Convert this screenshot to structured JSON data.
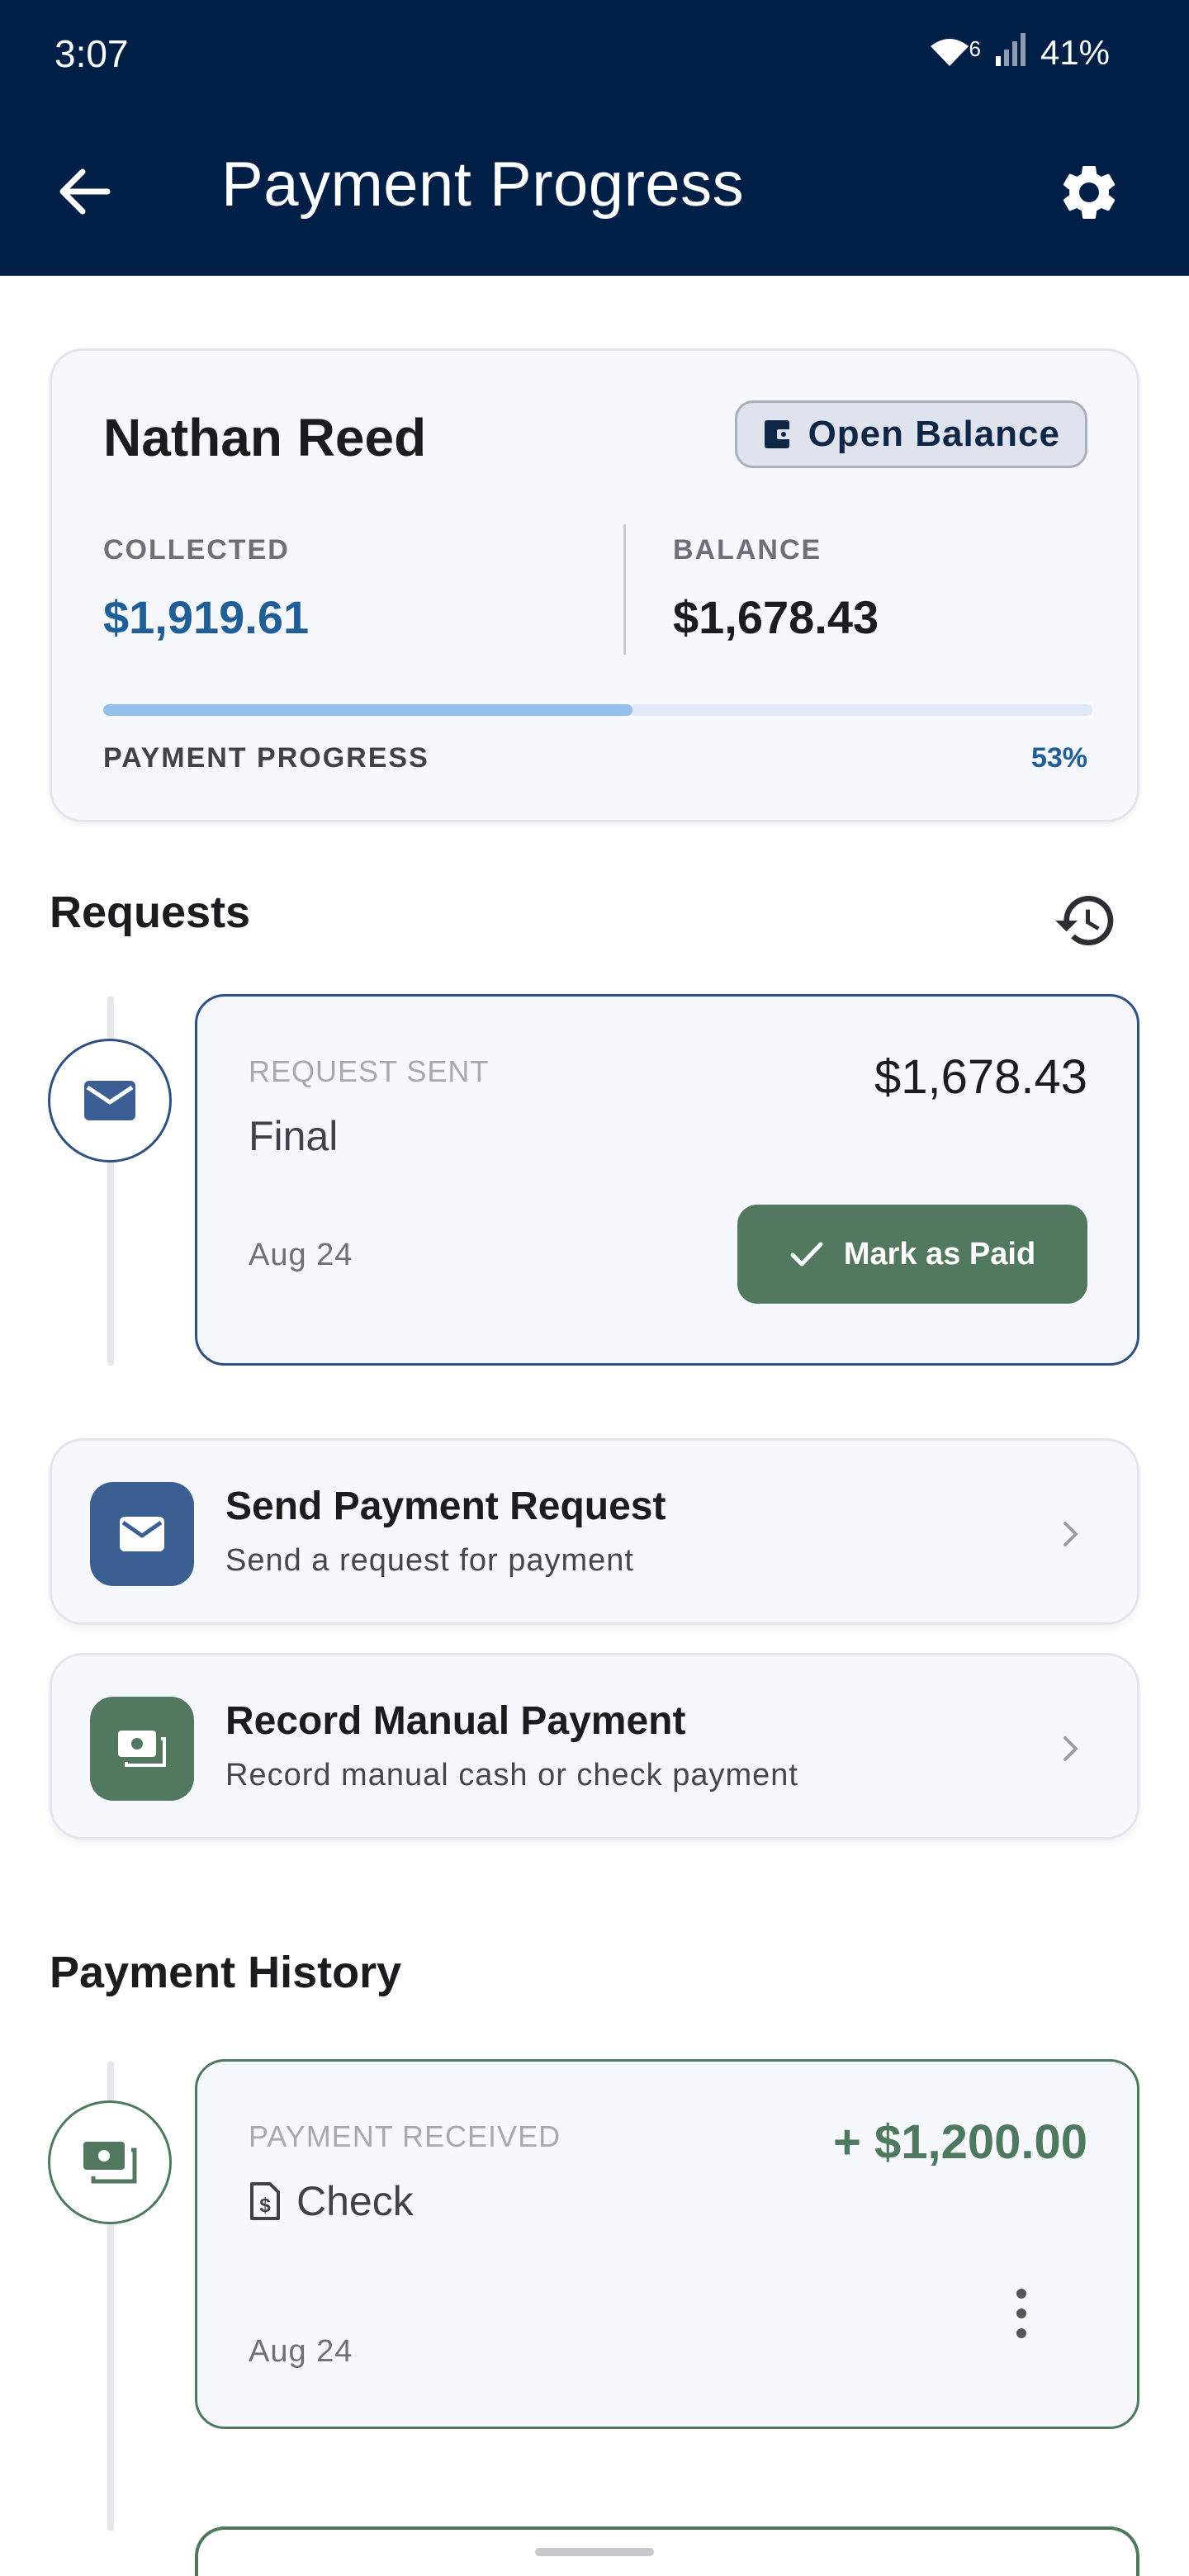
{
  "status_bar": {
    "time": "3:07",
    "wifi_badge": "6",
    "battery": "41%"
  },
  "appbar": {
    "title": "Payment Progress",
    "back_icon": "arrow-left-icon",
    "settings_icon": "gear-icon"
  },
  "summary": {
    "customer_name": "Nathan Reed",
    "badge_label": "Open Balance",
    "collected_label": "COLLECTED",
    "collected_value": "$1,919.61",
    "balance_label": "BALANCE",
    "balance_value": "$1,678.43",
    "progress_label": "PAYMENT PROGRESS",
    "progress_text": "53%",
    "progress_fraction": 0.535
  },
  "requests": {
    "title": "Requests",
    "items": [
      {
        "kind": "REQUEST SENT",
        "title": "Final",
        "amount": "$1,678.43",
        "date": "Aug 24",
        "action_label": "Mark as Paid"
      }
    ]
  },
  "actions": [
    {
      "title": "Send Payment Request",
      "subtitle": "Send a request for payment",
      "icon": "mail-icon"
    },
    {
      "title": "Record Manual Payment",
      "subtitle": "Record manual cash or check payment",
      "icon": "cash-icon"
    }
  ],
  "history": {
    "title": "Payment History",
    "items": [
      {
        "kind": "PAYMENT RECEIVED",
        "method": "Check",
        "amount": "+ $1,200.00",
        "date": "Aug 24"
      }
    ]
  },
  "colors": {
    "header": "#001f47",
    "accent_blue": "#1f5f99",
    "accent_green": "#4d7a5e"
  }
}
